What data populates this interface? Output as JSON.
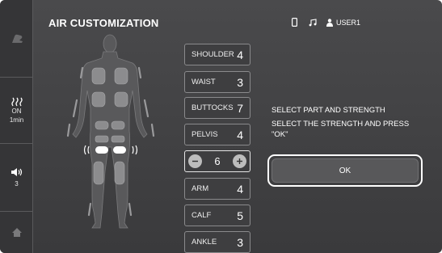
{
  "header": {
    "title": "AIR CUSTOMIZATION",
    "user": "USER1"
  },
  "sidebar": {
    "heat": {
      "state": "ON",
      "duration": "1min"
    },
    "volume": {
      "level": "3"
    }
  },
  "parts": [
    {
      "label": "SHOULDER",
      "value": "4"
    },
    {
      "label": "WAIST",
      "value": "3"
    },
    {
      "label": "BUTTOCKS",
      "value": "7"
    },
    {
      "label": "PELVIS",
      "value": "4"
    },
    {
      "label": "ARM",
      "value": "4"
    },
    {
      "label": "CALF",
      "value": "5"
    },
    {
      "label": "ANKLE",
      "value": "3"
    }
  ],
  "stepper": {
    "value": "6",
    "minus": "−",
    "plus": "+"
  },
  "instructions": {
    "line1": "SELECT PART AND STRENGTH",
    "line2": "SELECT THE STRENGTH AND PRESS",
    "line3": "\"OK\""
  },
  "ok_label": "OK",
  "colors": {
    "background": "#444446",
    "sidebar": "#353537",
    "highlight": "#ffffff"
  },
  "icons": [
    "chair-icon",
    "heat-icon",
    "speaker-icon",
    "home-icon",
    "phone-icon",
    "music-note-icon",
    "user-icon"
  ]
}
